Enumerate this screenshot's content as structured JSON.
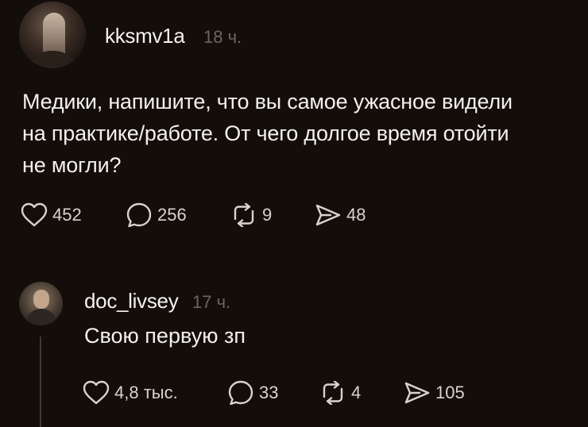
{
  "post": {
    "username": "kksmv1a",
    "time": "18 ч.",
    "text_lines": [
      "Медики, напишите, что вы самое ужасное видели",
      "на практике/работе. От чего долгое время отойти",
      "не могли?"
    ],
    "actions": {
      "likes": "452",
      "comments": "256",
      "reposts": "9",
      "shares": "48"
    }
  },
  "reply": {
    "username": "doc_livsey",
    "time": "17 ч.",
    "text": "Свою первую зп",
    "actions": {
      "likes": "4,8 тыс.",
      "comments": "33",
      "reposts": "4",
      "shares": "105"
    }
  },
  "icons": {
    "like": "heart-icon",
    "comment": "speech-bubble-icon",
    "repost": "repost-icon",
    "share": "send-icon"
  },
  "colors": {
    "background": "#140e0b",
    "text": "#f3f0ed",
    "muted": "#6d6560"
  }
}
